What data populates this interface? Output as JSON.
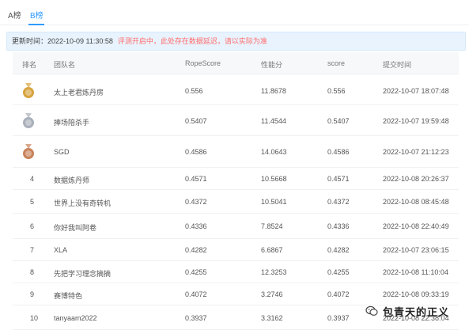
{
  "tabs": [
    {
      "label": "A榜"
    },
    {
      "label": "B榜"
    }
  ],
  "notice": {
    "update_time": "更新时间：2022-10-09 11:30:58",
    "warning": "评测开启中，此处存在数据延迟，请以实际为准"
  },
  "table": {
    "headers": [
      "排名",
      "团队名",
      "RopeScore",
      "性能分",
      "score",
      "提交时间"
    ],
    "rows": [
      {
        "rank": "1",
        "team": "太上老君炼丹房",
        "rope": "0.556",
        "perf": "11.8678",
        "score": "0.556",
        "time": "2022-10-07 18:07:48"
      },
      {
        "rank": "2",
        "team": "捧场陪杀手",
        "rope": "0.5407",
        "perf": "11.4544",
        "score": "0.5407",
        "time": "2022-10-07 19:59:48"
      },
      {
        "rank": "3",
        "team": "SGD",
        "rope": "0.4586",
        "perf": "14.0643",
        "score": "0.4586",
        "time": "2022-10-07 21:12:23"
      },
      {
        "rank": "4",
        "team": "数据炼丹师",
        "rope": "0.4571",
        "perf": "10.5668",
        "score": "0.4571",
        "time": "2022-10-08 20:26:37"
      },
      {
        "rank": "5",
        "team": "世界上没有奇转机",
        "rope": "0.4372",
        "perf": "10.5041",
        "score": "0.4372",
        "time": "2022-10-08 08:45:48"
      },
      {
        "rank": "6",
        "team": "你好我叫阿卷",
        "rope": "0.4336",
        "perf": "7.8524",
        "score": "0.4336",
        "time": "2022-10-08 22:40:49"
      },
      {
        "rank": "7",
        "team": "XLA",
        "rope": "0.4282",
        "perf": "6.6867",
        "score": "0.4282",
        "time": "2022-10-07 23:06:15"
      },
      {
        "rank": "8",
        "team": "先把学习理念摘摘",
        "rope": "0.4255",
        "perf": "12.3253",
        "score": "0.4255",
        "time": "2022-10-08 11:10:04"
      },
      {
        "rank": "9",
        "team": "赛博特色",
        "rope": "0.4072",
        "perf": "3.2746",
        "score": "0.4072",
        "time": "2022-10-08 09:33:19"
      },
      {
        "rank": "10",
        "team": "tanyaam2022",
        "rope": "0.3937",
        "perf": "3.3162",
        "score": "0.3937",
        "time": "2022-10-08 22:38:04"
      }
    ]
  },
  "watermark": {
    "text": "包青天的正义"
  },
  "colors": {
    "accent": "#2f9bff",
    "warning": "#ff6b6b",
    "gold": "#d8a440",
    "silver": "#a9b0bb",
    "bronze": "#c9835a"
  }
}
